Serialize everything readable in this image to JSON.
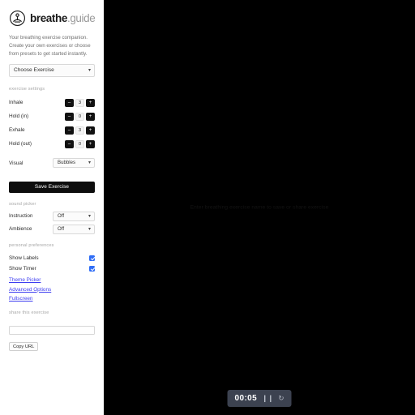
{
  "brand": {
    "name_strong": "breathe",
    "name_light": ".guide",
    "logo_icon": "breathing-figure-circle-icon",
    "tagline": "Your breathing exercise companion. Create your own exercises or choose from presets to get started instantly."
  },
  "exercise_select": {
    "value": "Choose Exercise",
    "caret_icon": "chevron-down-icon"
  },
  "exercise_settings": {
    "section_label": "exercise settings",
    "decrement_label": "–",
    "increment_label": "+",
    "rows": [
      {
        "label": "Inhale",
        "value": "3"
      },
      {
        "label": "Hold (in)",
        "value": "0"
      },
      {
        "label": "Exhale",
        "value": "3"
      },
      {
        "label": "Hold (out)",
        "value": "0"
      }
    ],
    "visual": {
      "label": "Visual",
      "value": "Bubbles",
      "caret_icon": "chevron-down-icon"
    },
    "save_label": "Save Exercise"
  },
  "sound_picker": {
    "section_label": "sound picker",
    "rows": [
      {
        "label": "Instruction",
        "value": "Off",
        "caret_icon": "chevron-down-icon"
      },
      {
        "label": "Ambience",
        "value": "Off",
        "caret_icon": "chevron-down-icon"
      }
    ]
  },
  "personal_preferences": {
    "section_label": "personal preferences",
    "toggles": [
      {
        "label": "Show Labels",
        "checked": true
      },
      {
        "label": "Show Timer",
        "checked": true
      }
    ],
    "links": [
      {
        "label": "Theme Picker"
      },
      {
        "label": "Advanced Options"
      },
      {
        "label": "Fullscreen"
      }
    ]
  },
  "share": {
    "section_label": "share this exercise",
    "url_value": "",
    "url_placeholder": "",
    "copy_label": "Copy URL"
  },
  "stage": {
    "hint_text": "Enter breathing exercise name to save or share exercise",
    "background_color": "#000000"
  },
  "timer": {
    "time": "00:05",
    "pause_icon": "❙❙",
    "reset_icon": "↻",
    "background_color": "#3c4250"
  }
}
